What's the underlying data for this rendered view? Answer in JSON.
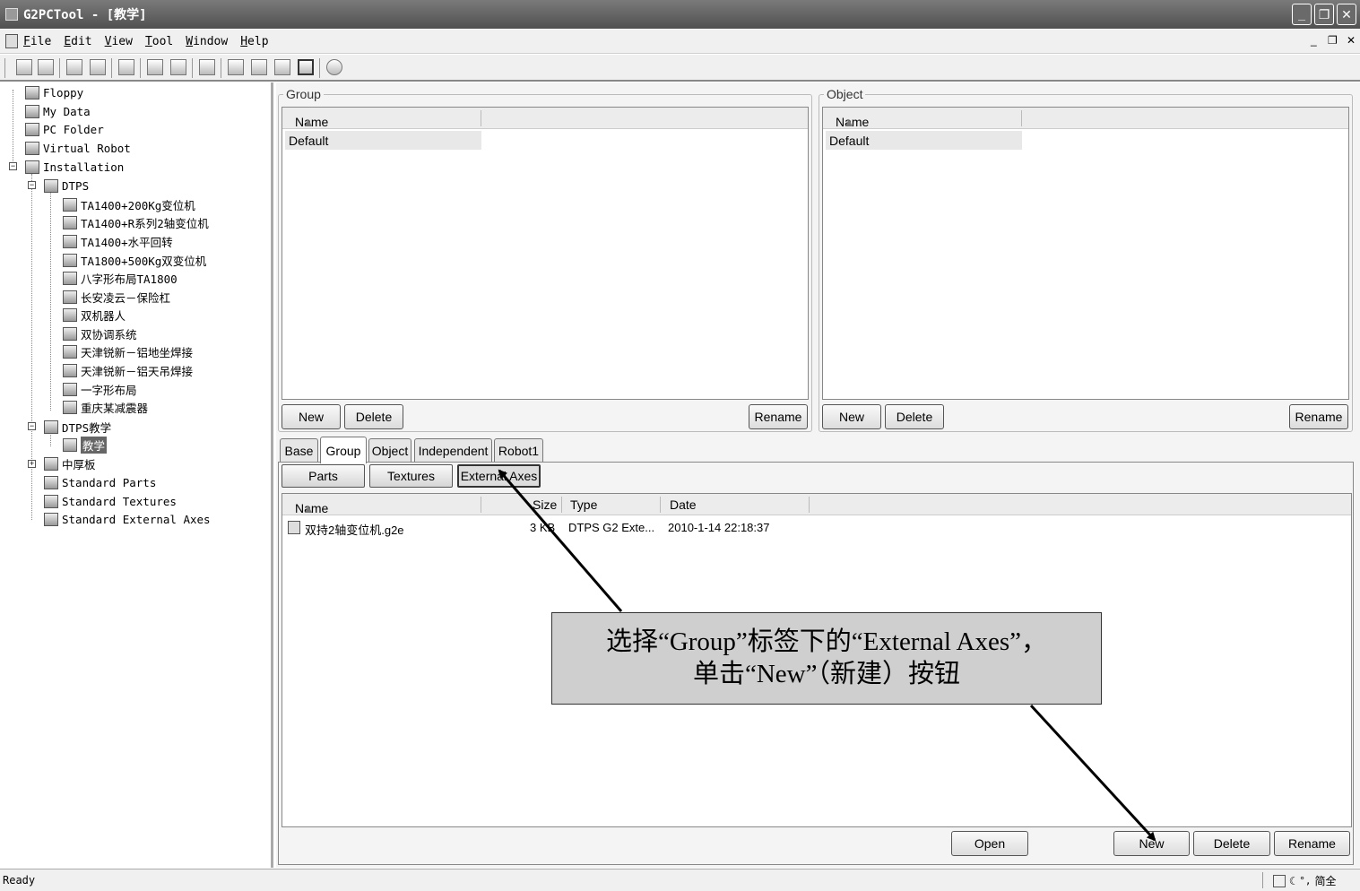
{
  "window": {
    "title": "G2PCTool - [教学]"
  },
  "menu": {
    "items": [
      "File",
      "Edit",
      "View",
      "Tool",
      "Window",
      "Help"
    ]
  },
  "tree": {
    "items": [
      {
        "label": "Floppy"
      },
      {
        "label": "My Data"
      },
      {
        "label": "PC Folder"
      },
      {
        "label": "Virtual Robot"
      },
      {
        "label": "Installation"
      },
      {
        "label": "DTPS"
      },
      {
        "label": "TA1400+200Kg变位机"
      },
      {
        "label": "TA1400+R系列2轴变位机"
      },
      {
        "label": "TA1400+水平回转"
      },
      {
        "label": "TA1800+500Kg双变位机"
      },
      {
        "label": "八字形布局TA1800"
      },
      {
        "label": "长安凌云－保险杠"
      },
      {
        "label": "双机器人"
      },
      {
        "label": "双协调系统"
      },
      {
        "label": "天津锐新－铝地坐焊接"
      },
      {
        "label": "天津锐新－铝天吊焊接"
      },
      {
        "label": "一字形布局"
      },
      {
        "label": "重庆某减震器"
      },
      {
        "label": "DTPS教学"
      },
      {
        "label": "教学"
      },
      {
        "label": "中厚板"
      },
      {
        "label": "Standard Parts"
      },
      {
        "label": "Standard Textures"
      },
      {
        "label": "Standard External Axes"
      }
    ]
  },
  "group_panel": {
    "legend": "Group",
    "col_name": "Name",
    "rows": [
      "Default"
    ],
    "new_label": "New",
    "delete_label": "Delete",
    "rename_label": "Rename"
  },
  "object_panel": {
    "legend": "Object",
    "col_name": "Name",
    "rows": [
      "Default"
    ],
    "new_label": "New",
    "delete_label": "Delete",
    "rename_label": "Rename"
  },
  "tabs": {
    "items": [
      "Base",
      "Group",
      "Object",
      "Independent",
      "Robot1"
    ],
    "active": "Group"
  },
  "subtabs": {
    "items": [
      "Parts",
      "Textures",
      "External Axes"
    ],
    "active": "External Axes"
  },
  "file_list": {
    "columns": {
      "name": "Name",
      "size": "Size",
      "type": "Type",
      "date": "Date"
    },
    "rows": [
      {
        "name": "双持2轴变位机.g2e",
        "size": "3 KB",
        "type": "DTPS G2 Exte...",
        "date": "2010-1-14 22:18:37"
      }
    ]
  },
  "bottom_buttons": {
    "open": "Open",
    "new": "New",
    "delete": "Delete",
    "rename": "Rename"
  },
  "callout": {
    "line1": "选择“Group”标签下的“External Axes”，",
    "line2": "单击“New”（新建）按钮"
  },
  "status": {
    "text": "Ready",
    "ime": "简全"
  }
}
